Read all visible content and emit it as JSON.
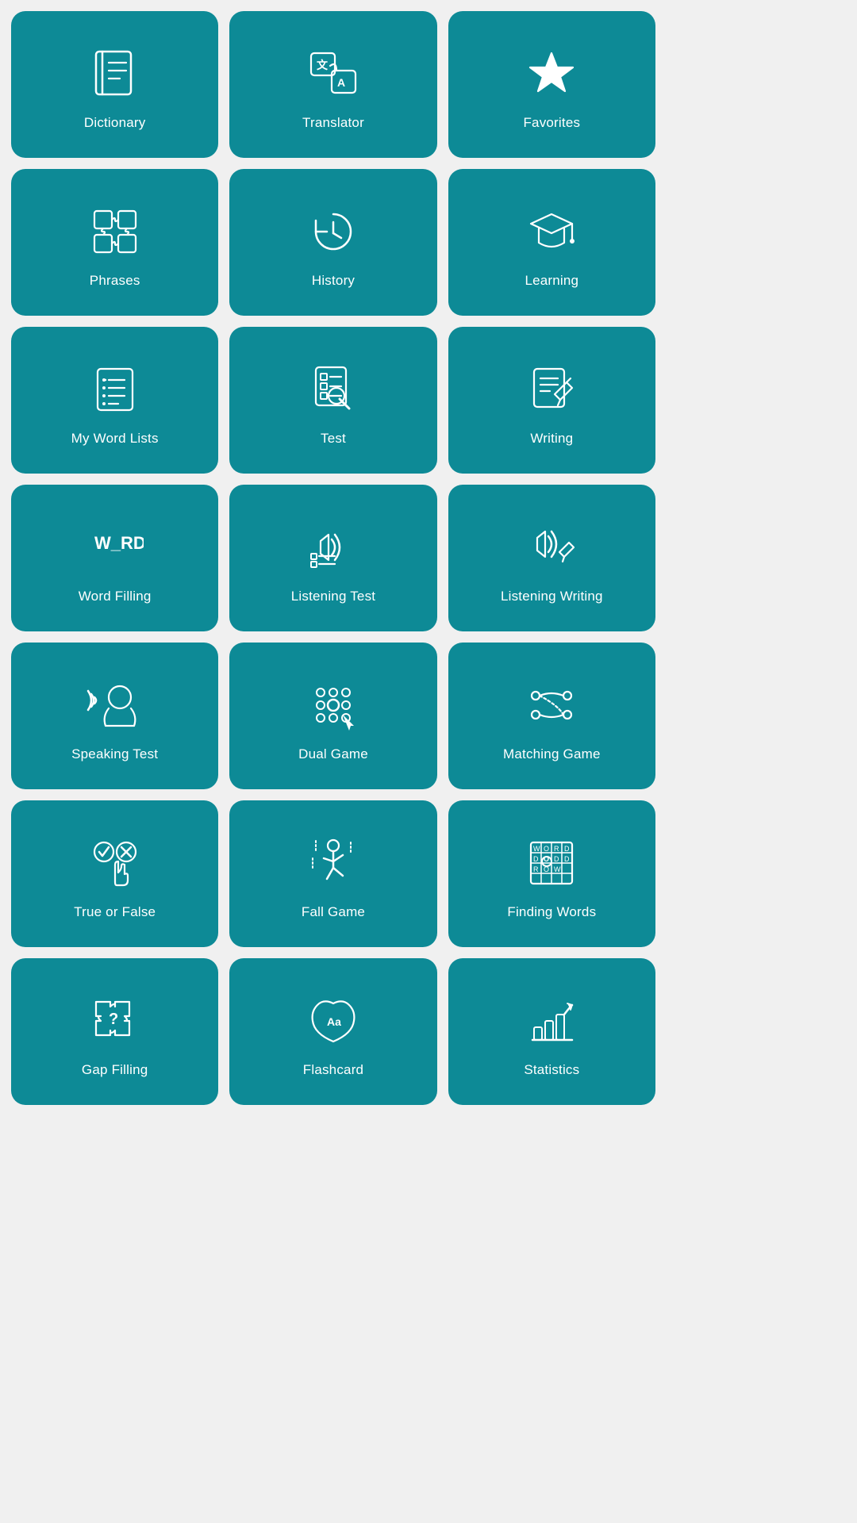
{
  "cards": [
    {
      "id": "dictionary",
      "label": "Dictionary"
    },
    {
      "id": "translator",
      "label": "Translator"
    },
    {
      "id": "favorites",
      "label": "Favorites"
    },
    {
      "id": "phrases",
      "label": "Phrases"
    },
    {
      "id": "history",
      "label": "History"
    },
    {
      "id": "learning",
      "label": "Learning"
    },
    {
      "id": "my-word-lists",
      "label": "My Word Lists"
    },
    {
      "id": "test",
      "label": "Test"
    },
    {
      "id": "writing",
      "label": "Writing"
    },
    {
      "id": "word-filling",
      "label": "Word Filling"
    },
    {
      "id": "listening-test",
      "label": "Listening Test"
    },
    {
      "id": "listening-writing",
      "label": "Listening Writing"
    },
    {
      "id": "speaking-test",
      "label": "Speaking Test"
    },
    {
      "id": "dual-game",
      "label": "Dual Game"
    },
    {
      "id": "matching-game",
      "label": "Matching Game"
    },
    {
      "id": "true-or-false",
      "label": "True or False"
    },
    {
      "id": "fall-game",
      "label": "Fall Game"
    },
    {
      "id": "finding-words",
      "label": "Finding Words"
    },
    {
      "id": "gap-filling",
      "label": "Gap Filling"
    },
    {
      "id": "flashcard",
      "label": "Flashcard"
    },
    {
      "id": "statistics",
      "label": "Statistics"
    }
  ]
}
